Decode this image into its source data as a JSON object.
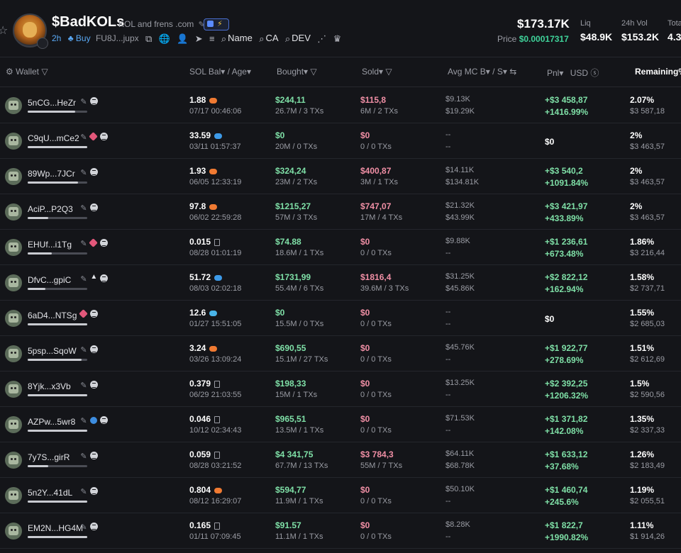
{
  "token": {
    "name": "$BadKOLs",
    "description": "KOL and frens .com",
    "age": "2h",
    "buy_label": "Buy",
    "address": "FU8J...jupx",
    "search_name": "Name",
    "search_ca": "CA",
    "search_dev": "DEV"
  },
  "stats": {
    "market_cap": "$173.17K",
    "price_label": "Price",
    "price": "$0.00017317",
    "liq_label": "Liq",
    "liq": "$48.9K",
    "vol_label": "24h Vol",
    "vol": "$153.2K",
    "total_label": "Tota",
    "total": "4.3"
  },
  "columns": {
    "wallet": "Wallet",
    "sol_bal": "SOL Bal",
    "age": "Age",
    "bought": "Bought",
    "sold": "Sold",
    "avg_mc": "Avg MC B",
    "avg_mc_s": "S",
    "pnl": "Pnl",
    "usd": "USD",
    "remaining": "Remaining%"
  },
  "colors": {
    "green": "#7fe0a7",
    "red": "#f08fa5",
    "accent": "#5aa9f5"
  },
  "rows": [
    {
      "wallet": "5nCG...HeZr",
      "bar": 0.8,
      "icons": [
        "pen",
        "menu"
      ],
      "sol": "1.88",
      "sol_icon": "shrimp",
      "time": "07/17 00:46:06",
      "bought": "$244,11",
      "bought_sub": "26.7M / 3 TXs",
      "sold": "$115,8",
      "sold_sub": "6M / 2 TXs",
      "mcb": "$9.13K",
      "mcs": "$19.29K",
      "pnl1": "+$3 458,87",
      "pnl2": "+1416.99%",
      "rem": "2.07%",
      "rem_usd": "$3 587,18"
    },
    {
      "wallet": "C9qU...mCe2",
      "bar": 1.0,
      "icons": [
        "pen",
        "tag",
        "menu"
      ],
      "sol": "33.59",
      "sol_icon": "dolphin",
      "time": "03/11 01:57:37",
      "bought": "$0",
      "bought_sub": "20M / 0 TXs",
      "sold": "$0",
      "sold_sub": "0 / 0 TXs",
      "mcb": "--",
      "mcs": "--",
      "pnl1": "$0",
      "pnl2": "",
      "rem": "2%",
      "rem_usd": "$3 463,57"
    },
    {
      "wallet": "89Wp...7JCr",
      "bar": 0.85,
      "icons": [
        "pen",
        "menu"
      ],
      "sol": "1.93",
      "sol_icon": "shrimp",
      "time": "06/05 12:33:19",
      "bought": "$324,24",
      "bought_sub": "23M / 2 TXs",
      "sold": "$400,87",
      "sold_sub": "3M / 1 TXs",
      "mcb": "$14.11K",
      "mcs": "$134.81K",
      "pnl1": "+$3 540,2",
      "pnl2": "+1091.84%",
      "rem": "2%",
      "rem_usd": "$3 463,57"
    },
    {
      "wallet": "AciP...P2Q3",
      "bar": 0.35,
      "icons": [
        "pen",
        "menu"
      ],
      "sol": "97.8",
      "sol_icon": "shrimp",
      "time": "06/02 22:59:28",
      "bought": "$1215,27",
      "bought_sub": "57M / 3 TXs",
      "sold": "$747,07",
      "sold_sub": "17M / 4 TXs",
      "mcb": "$21.32K",
      "mcs": "$43.99K",
      "pnl1": "+$3 421,97",
      "pnl2": "+433.89%",
      "rem": "2%",
      "rem_usd": "$3 463,57"
    },
    {
      "wallet": "EHUf...i1Tg",
      "bar": 0.4,
      "icons": [
        "pen",
        "tag",
        "menu"
      ],
      "sol": "0.015",
      "sol_icon": "empty",
      "time": "08/28 01:01:19",
      "bought": "$74.88",
      "bought_sub": "18.6M / 1 TXs",
      "sold": "$0",
      "sold_sub": "0 / 0 TXs",
      "mcb": "$9.88K",
      "mcs": "--",
      "pnl1": "+$1 236,61",
      "pnl2": "+673.48%",
      "rem": "1.86%",
      "rem_usd": "$3 216,44"
    },
    {
      "wallet": "DfvC...gpiC",
      "bar": 0.3,
      "icons": [
        "pen",
        "tri",
        "menu"
      ],
      "sol": "51.72",
      "sol_icon": "dolphin",
      "time": "08/03 02:02:18",
      "bought": "$1731,99",
      "bought_sub": "55.4M / 6 TXs",
      "sold": "$1816,4",
      "sold_sub": "39.6M / 3 TXs",
      "mcb": "$31.25K",
      "mcs": "$45.86K",
      "pnl1": "+$2 822,12",
      "pnl2": "+162.94%",
      "rem": "1.58%",
      "rem_usd": "$2 737,71"
    },
    {
      "wallet": "6aD4...NTSg",
      "bar": 1.0,
      "icons": [
        "tag",
        "menu"
      ],
      "sol": "12.6",
      "sol_icon": "fish",
      "time": "01/27 15:51:05",
      "bought": "$0",
      "bought_sub": "15.5M / 0 TXs",
      "sold": "$0",
      "sold_sub": "0 / 0 TXs",
      "mcb": "--",
      "mcs": "--",
      "pnl1": "$0",
      "pnl2": "",
      "rem": "1.55%",
      "rem_usd": "$2 685,03"
    },
    {
      "wallet": "5psp...SqoW",
      "bar": 0.9,
      "icons": [
        "pen",
        "menu"
      ],
      "sol": "3.24",
      "sol_icon": "shrimp",
      "time": "03/26 13:09:24",
      "bought": "$690,55",
      "bought_sub": "15.1M / 27 TXs",
      "sold": "$0",
      "sold_sub": "0 / 0 TXs",
      "mcb": "$45.76K",
      "mcs": "--",
      "pnl1": "+$1 922,77",
      "pnl2": "+278.69%",
      "rem": "1.51%",
      "rem_usd": "$2 612,69"
    },
    {
      "wallet": "8Yjk...x3Vb",
      "bar": 1.0,
      "icons": [
        "pen",
        "menu"
      ],
      "sol": "0.379",
      "sol_icon": "empty",
      "time": "06/29 21:03:55",
      "bought": "$198,33",
      "bought_sub": "15M / 1 TXs",
      "sold": "$0",
      "sold_sub": "0 / 0 TXs",
      "mcb": "$13.25K",
      "mcs": "--",
      "pnl1": "+$2 392,25",
      "pnl2": "+1206.32%",
      "rem": "1.5%",
      "rem_usd": "$2 590,56"
    },
    {
      "wallet": "AZPw...5wr8",
      "bar": 1.0,
      "icons": [
        "pen",
        "fish",
        "menu"
      ],
      "sol": "0.046",
      "sol_icon": "empty",
      "time": "10/12 02:34:43",
      "bought": "$965,51",
      "bought_sub": "13.5M / 1 TXs",
      "sold": "$0",
      "sold_sub": "0 / 0 TXs",
      "mcb": "$71.53K",
      "mcs": "--",
      "pnl1": "+$1 371,82",
      "pnl2": "+142.08%",
      "rem": "1.35%",
      "rem_usd": "$2 337,33"
    },
    {
      "wallet": "7y7S...girR",
      "bar": 0.35,
      "icons": [
        "pen",
        "menu"
      ],
      "sol": "0.059",
      "sol_icon": "empty",
      "time": "08/28 03:21:52",
      "bought": "$4 341,75",
      "bought_sub": "67.7M / 13 TXs",
      "sold": "$3 784,3",
      "sold_sub": "55M / 7 TXs",
      "mcb": "$64.11K",
      "mcs": "$68.78K",
      "pnl1": "+$1 633,12",
      "pnl2": "+37.68%",
      "rem": "1.26%",
      "rem_usd": "$2 183,49"
    },
    {
      "wallet": "5n2Y...41dL",
      "bar": 1.0,
      "icons": [
        "pen",
        "menu"
      ],
      "sol": "0.804",
      "sol_icon": "shrimp",
      "time": "08/12 16:29:07",
      "bought": "$594,77",
      "bought_sub": "11.9M / 1 TXs",
      "sold": "$0",
      "sold_sub": "0 / 0 TXs",
      "mcb": "$50.10K",
      "mcs": "--",
      "pnl1": "+$1 460,74",
      "pnl2": "+245.6%",
      "rem": "1.19%",
      "rem_usd": "$2 055,51"
    },
    {
      "wallet": "EM2N...HG4M",
      "bar": 1.0,
      "icons": [
        "pen",
        "menu"
      ],
      "sol": "0.165",
      "sol_icon": "empty",
      "time": "01/11 07:09:45",
      "bought": "$91.57",
      "bought_sub": "11.1M / 1 TXs",
      "sold": "$0",
      "sold_sub": "0 / 0 TXs",
      "mcb": "$8.28K",
      "mcs": "--",
      "pnl1": "+$1 822,7",
      "pnl2": "+1990.82%",
      "rem": "1.11%",
      "rem_usd": "$1 914,26"
    }
  ]
}
